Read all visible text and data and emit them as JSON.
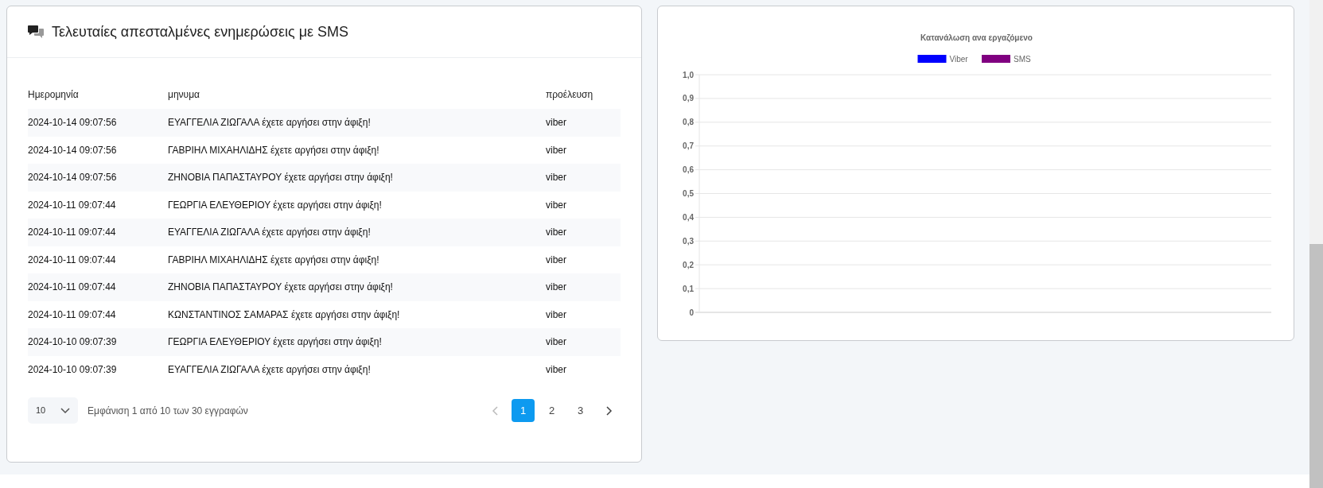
{
  "messages_card": {
    "title": "Τελευταίες απεσταλμένες ενημερώσεις με SMS",
    "table": {
      "columns": [
        "Ημερομηνία",
        "μηνυμα",
        "προέλευση"
      ],
      "rows": [
        [
          "2024-10-14 09:07:56",
          "ΕΥΑΓΓΕΛΙΑ ΖΙΩΓΑΛΑ έχετε αργήσει στην άφιξη!",
          "viber"
        ],
        [
          "2024-10-14 09:07:56",
          "ΓΑΒΡΙΗΛ ΜΙΧΑΗΛΙΔΗΣ έχετε αργήσει στην άφιξη!",
          "viber"
        ],
        [
          "2024-10-14 09:07:56",
          "ΖΗΝΟΒΙΑ ΠΑΠΑΣΤΑΥΡΟΥ έχετε αργήσει στην άφιξη!",
          "viber"
        ],
        [
          "2024-10-11 09:07:44",
          "ΓΕΩΡΓΙΑ ΕΛΕΥΘΕΡΙΟΥ έχετε αργήσει στην άφιξη!",
          "viber"
        ],
        [
          "2024-10-11 09:07:44",
          "ΕΥΑΓΓΕΛΙΑ ΖΙΩΓΑΛΑ έχετε αργήσει στην άφιξη!",
          "viber"
        ],
        [
          "2024-10-11 09:07:44",
          "ΓΑΒΡΙΗΛ ΜΙΧΑΗΛΙΔΗΣ έχετε αργήσει στην άφιξη!",
          "viber"
        ],
        [
          "2024-10-11 09:07:44",
          "ΖΗΝΟΒΙΑ ΠΑΠΑΣΤΑΥΡΟΥ έχετε αργήσει στην άφιξη!",
          "viber"
        ],
        [
          "2024-10-11 09:07:44",
          "ΚΩΝΣΤΑΝΤΙΝΟΣ ΣΑΜΑΡΑΣ έχετε αργήσει στην άφιξη!",
          "viber"
        ],
        [
          "2024-10-10 09:07:39",
          "ΓΕΩΡΓΙΑ ΕΛΕΥΘΕΡΙΟΥ έχετε αργήσει στην άφιξη!",
          "viber"
        ],
        [
          "2024-10-10 09:07:39",
          "ΕΥΑΓΓΕΛΙΑ ΖΙΩΓΑΛΑ έχετε αργήσει στην άφιξη!",
          "viber"
        ]
      ]
    },
    "page_size": "10",
    "info": "Εμφάνιση 1 από 10 των 30 εγγραφών",
    "pages": [
      {
        "label": "1",
        "selected": true
      },
      {
        "label": "2",
        "selected": false
      },
      {
        "label": "3",
        "selected": false
      }
    ]
  },
  "chart_card": {
    "chart_data": {
      "type": "bar",
      "title": "Κατανάλωση ανα εργαζόμενο",
      "series": [
        {
          "name": "Viber",
          "color": "#0000ff"
        },
        {
          "name": "SMS",
          "color": "#800080"
        }
      ],
      "ylim": [
        0,
        1
      ],
      "grid": true,
      "yticks": [
        {
          "value": 0,
          "label": "0"
        },
        {
          "value": 0.1,
          "label": "0,1"
        },
        {
          "value": 0.2,
          "label": "0,2"
        },
        {
          "value": 0.3,
          "label": "0,3"
        },
        {
          "value": 0.4,
          "label": "0,4"
        },
        {
          "value": 0.5,
          "label": "0,5"
        },
        {
          "value": 0.6,
          "label": "0,6"
        },
        {
          "value": 0.7,
          "label": "0,7"
        },
        {
          "value": 0.8,
          "label": "0,8"
        },
        {
          "value": 0.9,
          "label": "0,9"
        },
        {
          "value": 1,
          "label": "1,0"
        }
      ]
    }
  }
}
